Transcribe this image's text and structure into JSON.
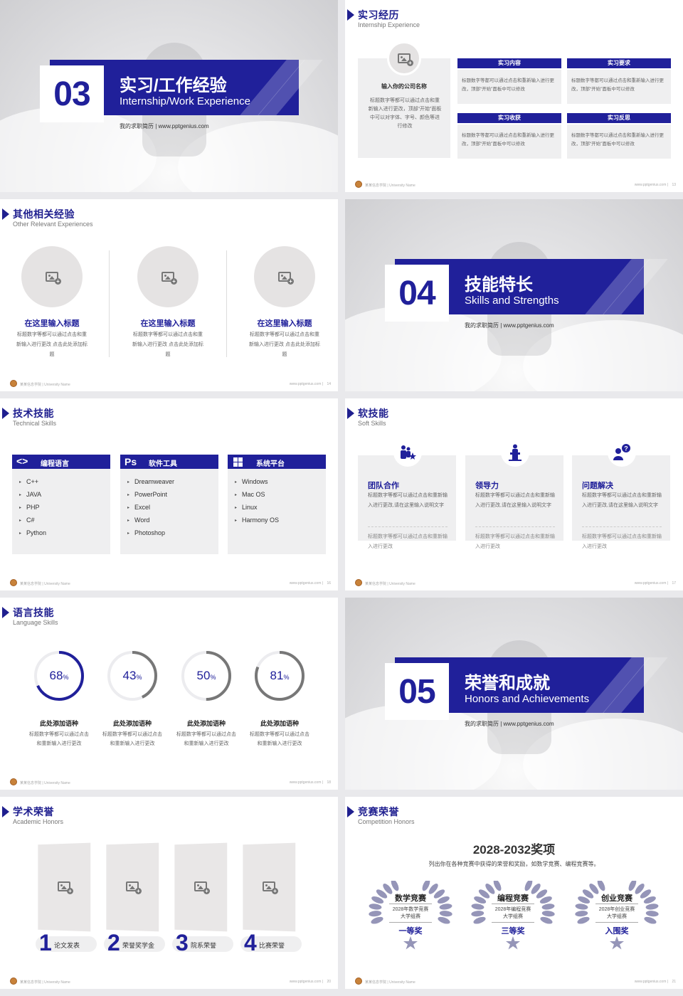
{
  "footer": {
    "university": "某某信息学院 | University Name",
    "url": "www.pptgenius.com"
  },
  "s1": {
    "num": "03",
    "cn": "实习/工作经验",
    "en": "Internship/Work Experience",
    "site": "我的求职简历 | www.pptgenius.com"
  },
  "s2": {
    "cn": "实习经历",
    "en": "Internship Experience",
    "company_label": "输入你的公司名称",
    "company_desc": "标题数字等都可以通过点击和重新输入进行更改，顶部“开始”面板中可以对字体、字号、颜色等进行修改",
    "boxes": [
      {
        "title": "实习内容",
        "text": "标题数字等都可以通过点击和重新输入进行更改，顶部“开始”面板中可以修改"
      },
      {
        "title": "实习要求",
        "text": "标题数字等都可以通过点击和重新输入进行更改，顶部“开始”面板中可以修改"
      },
      {
        "title": "实习收获",
        "text": "标题数字等都可以通过点击和重新输入进行更改，顶部“开始”面板中可以修改"
      },
      {
        "title": "实习反思",
        "text": "标题数字等都可以通过点击和重新输入进行更改，顶部“开始”面板中可以修改"
      }
    ],
    "page": "13"
  },
  "s3": {
    "cn": "其他相关经验",
    "en": "Other Relevant Experiences",
    "items": [
      {
        "title": "在这里输入标题",
        "text": "标题数字等都可以通过点击和重新输入进行更改 点击此处添加标题"
      },
      {
        "title": "在这里输入标题",
        "text": "标题数字等都可以通过点击和重新输入进行更改 点击此处添加标题"
      },
      {
        "title": "在这里输入标题",
        "text": "标题数字等都可以通过点击和重新输入进行更改 点击此处添加标题"
      }
    ],
    "page": "14"
  },
  "s4": {
    "num": "04",
    "cn": "技能特长",
    "en": "Skills and Strengths",
    "site": "我的求职简历 | www.pptgenius.com"
  },
  "s5": {
    "cn": "技术技能",
    "en": "Technical Skills",
    "cols": [
      {
        "icon": "<>",
        "title": "编程语言",
        "items": [
          "C++",
          "JAVA",
          "PHP",
          "C#",
          "Python"
        ]
      },
      {
        "icon": "Ps",
        "title": "软件工具",
        "items": [
          "Dreamweaver",
          "PowerPoint",
          "Excel",
          "Word",
          "Photoshop"
        ]
      },
      {
        "icon": "win",
        "title": "系统平台",
        "items": [
          "Windows",
          "Mac OS",
          "Linux",
          "Harmony OS"
        ]
      }
    ],
    "page": "16"
  },
  "s6": {
    "cn": "软技能",
    "en": "Soft Skills",
    "cards": [
      {
        "title": "团队合作",
        "text": "标题数字等都可以通过点击和重新输入进行更改,请在这里输入说明文字",
        "sub": "标题数字等都可以通过点击和重新输入进行更改"
      },
      {
        "title": "领导力",
        "text": "标题数字等都可以通过点击和重新输入进行更改,请在这里输入说明文字",
        "sub": "标题数字等都可以通过点击和重新输入进行更改"
      },
      {
        "title": "问题解决",
        "text": "标题数字等都可以通过点击和重新输入进行更改,请在这里输入说明文字",
        "sub": "标题数字等都可以通过点击和重新输入进行更改"
      }
    ],
    "page": "17"
  },
  "s7": {
    "cn": "语言技能",
    "en": "Language Skills",
    "rings": [
      {
        "value": 68,
        "label": "68",
        "unit": "%",
        "title": "此处添加语种",
        "text": "标题数字等都可以通过点击和重新输入进行更改",
        "color": "#20209a"
      },
      {
        "value": 43,
        "label": "43",
        "unit": "%",
        "title": "此处添加语种",
        "text": "标题数字等都可以通过点击和重新输入进行更改",
        "color": "#777777"
      },
      {
        "value": 50,
        "label": "50",
        "unit": "%",
        "title": "此处添加语种",
        "text": "标题数字等都可以通过点击和重新输入进行更改",
        "color": "#777777"
      },
      {
        "value": 81,
        "label": "81",
        "unit": "%",
        "title": "此处添加语种",
        "text": "标题数字等都可以通过点击和重新输入进行更改",
        "color": "#777777"
      }
    ],
    "page": "18"
  },
  "s8": {
    "num": "05",
    "cn": "荣誉和成就",
    "en": "Honors and Achievements",
    "site": "我的求职简历 | www.pptgenius.com"
  },
  "s9": {
    "cn": "学术荣誉",
    "en": "Academic Honors",
    "items": [
      {
        "n": "1",
        "label": "论文发表"
      },
      {
        "n": "2",
        "label": "荣誉奖学金"
      },
      {
        "n": "3",
        "label": "院系荣誉"
      },
      {
        "n": "4",
        "label": "比赛荣誉"
      }
    ],
    "page": "20"
  },
  "s10": {
    "cn": "竞赛荣誉",
    "en": "Competition Honors",
    "heading": "2028-2032奖项",
    "desc": "列出你在各种竞赛中获得的荣誉和奖励，如数学竞赛、编程竞赛等。",
    "awards": [
      {
        "title": "数学竞赛",
        "line1": "2028年数学竞赛",
        "line2": "大学组赛",
        "prize": "一等奖"
      },
      {
        "title": "编程竞赛",
        "line1": "2028年编程竞赛",
        "line2": "大学组赛",
        "prize": "三等奖"
      },
      {
        "title": "创业竞赛",
        "line1": "2028年创业竞赛",
        "line2": "大学组赛",
        "prize": "入围奖"
      }
    ],
    "page": "21"
  }
}
